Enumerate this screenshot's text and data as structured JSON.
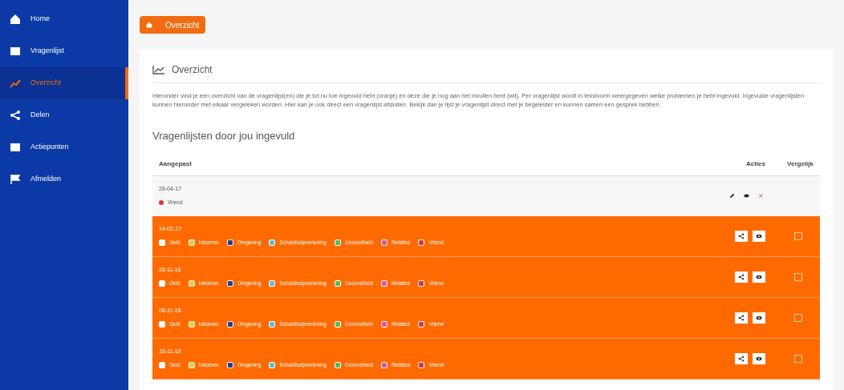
{
  "sidebar": {
    "items": [
      {
        "label": "Home",
        "selected": false
      },
      {
        "label": "Vragenlijst",
        "selected": false
      },
      {
        "label": "Overzicht",
        "selected": true
      },
      {
        "label": "Delen",
        "selected": false
      },
      {
        "label": "Actiepunten",
        "selected": false
      },
      {
        "label": "Afmelden",
        "selected": false
      }
    ]
  },
  "breadcrumb": {
    "label": "Overzicht"
  },
  "panel": {
    "title": "Overzicht",
    "intro": "Hieronder vind je een overzicht van de vragenlijst(en) die je tot nu toe ingevuld hebt (oranje) en deze die je nog aan het invullen bent (wit). Per vragenlijst wordt in tekstvorm weergegeven welke problemen je hebt ingevuld. Ingevulde vragenlijsten kunnen hieronder met elkaar vergeleken worden. Hier kan je ook direct een vragenlijst afsluiten. Bekijk dan je lijst je vragenlijst direct met je begeleider en kunnen samen een gesprek hebben.",
    "subtitle": "Vragenlijsten door jou ingevuld"
  },
  "table": {
    "columns": [
      "Aangepast",
      "Acties",
      "Vergelijk"
    ],
    "rows": [
      {
        "date": "28-04-17",
        "completed": false,
        "tags": [
          {
            "label": "Vriend",
            "color": "#d9383a"
          }
        ]
      },
      {
        "date": "14-02-17",
        "completed": true,
        "compare": false,
        "tags": [
          {
            "label": "Geld",
            "color": "#ffffff"
          },
          {
            "label": "Inkomen",
            "color": "#f5c842"
          },
          {
            "label": "Omgeving",
            "color": "#2a3a8c"
          },
          {
            "label": "Schuldhulpverlening",
            "color": "#5bc0de"
          },
          {
            "label": "Gezondheid",
            "color": "#5cb85c"
          },
          {
            "label": "Relaties",
            "color": "#e0569a"
          },
          {
            "label": "Vriend",
            "color": "#d9383a"
          }
        ]
      },
      {
        "date": "28-11-16",
        "completed": true,
        "compare": false,
        "tags": [
          {
            "label": "Geld",
            "color": "#ffffff"
          },
          {
            "label": "Inkomen",
            "color": "#f5c842"
          },
          {
            "label": "Omgeving",
            "color": "#2a3a8c"
          },
          {
            "label": "Schuldhulpverlening",
            "color": "#5bc0de"
          },
          {
            "label": "Gezondheid",
            "color": "#5cb85c"
          },
          {
            "label": "Relaties",
            "color": "#e0569a"
          },
          {
            "label": "Vriend",
            "color": "#d9383a"
          }
        ]
      },
      {
        "date": "08-11-16",
        "completed": true,
        "compare": false,
        "tags": [
          {
            "label": "Geld",
            "color": "#ffffff"
          },
          {
            "label": "Inkomen",
            "color": "#f5c842"
          },
          {
            "label": "Omgeving",
            "color": "#2a3a8c"
          },
          {
            "label": "Schuldhulpverlening",
            "color": "#5bc0de"
          },
          {
            "label": "Gezondheid",
            "color": "#5cb85c"
          },
          {
            "label": "Relaties",
            "color": "#e0569a"
          },
          {
            "label": "Vriend",
            "color": "#d9383a"
          }
        ]
      },
      {
        "date": "16-11-16",
        "completed": true,
        "compare": false,
        "tags": [
          {
            "label": "Geld",
            "color": "#ffffff"
          },
          {
            "label": "Inkomen",
            "color": "#f5c842"
          },
          {
            "label": "Omgeving",
            "color": "#2a3a8c"
          },
          {
            "label": "Schuldhulpverlening",
            "color": "#5bc0de"
          },
          {
            "label": "Gezondheid",
            "color": "#5cb85c"
          },
          {
            "label": "Relaties",
            "color": "#e0569a"
          },
          {
            "label": "Vriend",
            "color": "#d9383a"
          }
        ]
      }
    ]
  }
}
